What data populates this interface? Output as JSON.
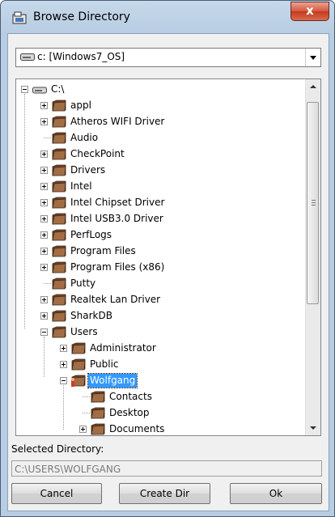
{
  "window": {
    "title": "Browse Directory",
    "close_glyph": "x"
  },
  "drive": {
    "label": "c: [Windows7_OS]"
  },
  "tree": [
    {
      "label": "C:\\",
      "depth": 0,
      "expander": "minus",
      "icon": "drive-icon"
    },
    {
      "label": "appl",
      "depth": 1,
      "expander": "plus",
      "icon": "folder-icon"
    },
    {
      "label": "Atheros WIFI Driver",
      "depth": 1,
      "expander": "plus",
      "icon": "folder-icon"
    },
    {
      "label": "Audio",
      "depth": 1,
      "expander": "none",
      "icon": "folder-icon"
    },
    {
      "label": "CheckPoint",
      "depth": 1,
      "expander": "plus",
      "icon": "folder-icon"
    },
    {
      "label": "Drivers",
      "depth": 1,
      "expander": "plus",
      "icon": "folder-icon"
    },
    {
      "label": "Intel",
      "depth": 1,
      "expander": "plus",
      "icon": "folder-icon"
    },
    {
      "label": "Intel Chipset Driver",
      "depth": 1,
      "expander": "plus",
      "icon": "folder-icon"
    },
    {
      "label": "Intel USB3.0 Driver",
      "depth": 1,
      "expander": "plus",
      "icon": "folder-icon"
    },
    {
      "label": "PerfLogs",
      "depth": 1,
      "expander": "plus",
      "icon": "folder-icon"
    },
    {
      "label": "Program Files",
      "depth": 1,
      "expander": "plus",
      "icon": "folder-icon"
    },
    {
      "label": "Program Files (x86)",
      "depth": 1,
      "expander": "plus",
      "icon": "folder-icon"
    },
    {
      "label": "Putty",
      "depth": 1,
      "expander": "none",
      "icon": "folder-icon"
    },
    {
      "label": "Realtek Lan Driver",
      "depth": 1,
      "expander": "plus",
      "icon": "folder-icon"
    },
    {
      "label": "SharkDB",
      "depth": 1,
      "expander": "plus",
      "icon": "folder-icon"
    },
    {
      "label": "Users",
      "depth": 1,
      "expander": "minus",
      "icon": "folder-icon"
    },
    {
      "label": "Administrator",
      "depth": 2,
      "expander": "plus",
      "icon": "folder-icon"
    },
    {
      "label": "Public",
      "depth": 2,
      "expander": "plus",
      "icon": "folder-icon"
    },
    {
      "label": "Wolfgang",
      "depth": 2,
      "expander": "minus",
      "icon": "user-folder-icon",
      "selected": true
    },
    {
      "label": "Contacts",
      "depth": 3,
      "expander": "none",
      "icon": "folder-icon"
    },
    {
      "label": "Desktop",
      "depth": 3,
      "expander": "none",
      "icon": "folder-icon"
    },
    {
      "label": "Documents",
      "depth": 3,
      "expander": "plus",
      "icon": "folder-icon"
    }
  ],
  "selected_directory": {
    "label": "Selected Directory:",
    "value": "C:\\USERS\\WOLFGANG"
  },
  "buttons": {
    "cancel": "Cancel",
    "create_dir": "Create Dir",
    "ok": "Ok"
  },
  "colors": {
    "selection": "#3399ff",
    "title_bar": "#b8cde3",
    "close_button": "#c23b1f",
    "folder": "#8a5a3a"
  }
}
